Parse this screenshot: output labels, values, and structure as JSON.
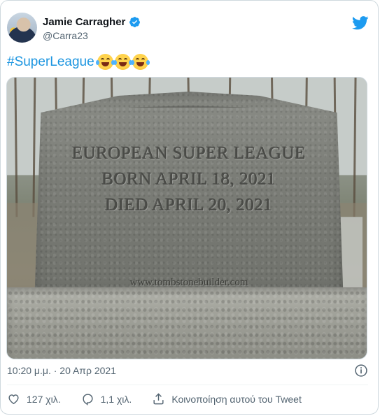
{
  "author": {
    "name": "Jamie Carragher",
    "handle": "@Carra23",
    "verified": true
  },
  "tweet": {
    "hashtag": "#SuperLeague",
    "emojis": [
      "face-with-tears-of-joy",
      "face-with-tears-of-joy",
      "face-with-tears-of-joy"
    ]
  },
  "media": {
    "lines": [
      "EUROPEAN SUPER LEAGUE",
      "BORN APRIL 18, 2021",
      "DIED APRIL 20, 2021"
    ],
    "watermark": "www.tombstonebuilder.com"
  },
  "meta": {
    "timestamp": "10:20 μ.μ. · 20 Απρ 2021"
  },
  "actions": {
    "likes": "127 χιλ.",
    "replies": "1,1 χιλ.",
    "share": "Κοινοποίηση αυτού του Tweet"
  },
  "colors": {
    "link": "#1b95e0",
    "twitter_blue": "#1d9bf0",
    "secondary_text": "#536471"
  }
}
